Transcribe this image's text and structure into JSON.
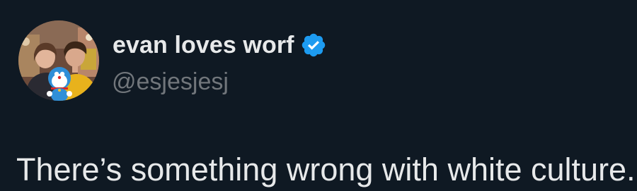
{
  "author": {
    "display_name": "evan loves worf",
    "handle": "@esjesjesj",
    "verified": true,
    "verified_badge_color": "#1d9bf0"
  },
  "tweet": {
    "text": "There’s something wrong with white culture."
  },
  "theme": {
    "background": "#0f1923",
    "primary_text": "#e7e9ea",
    "secondary_text": "#71767b"
  }
}
